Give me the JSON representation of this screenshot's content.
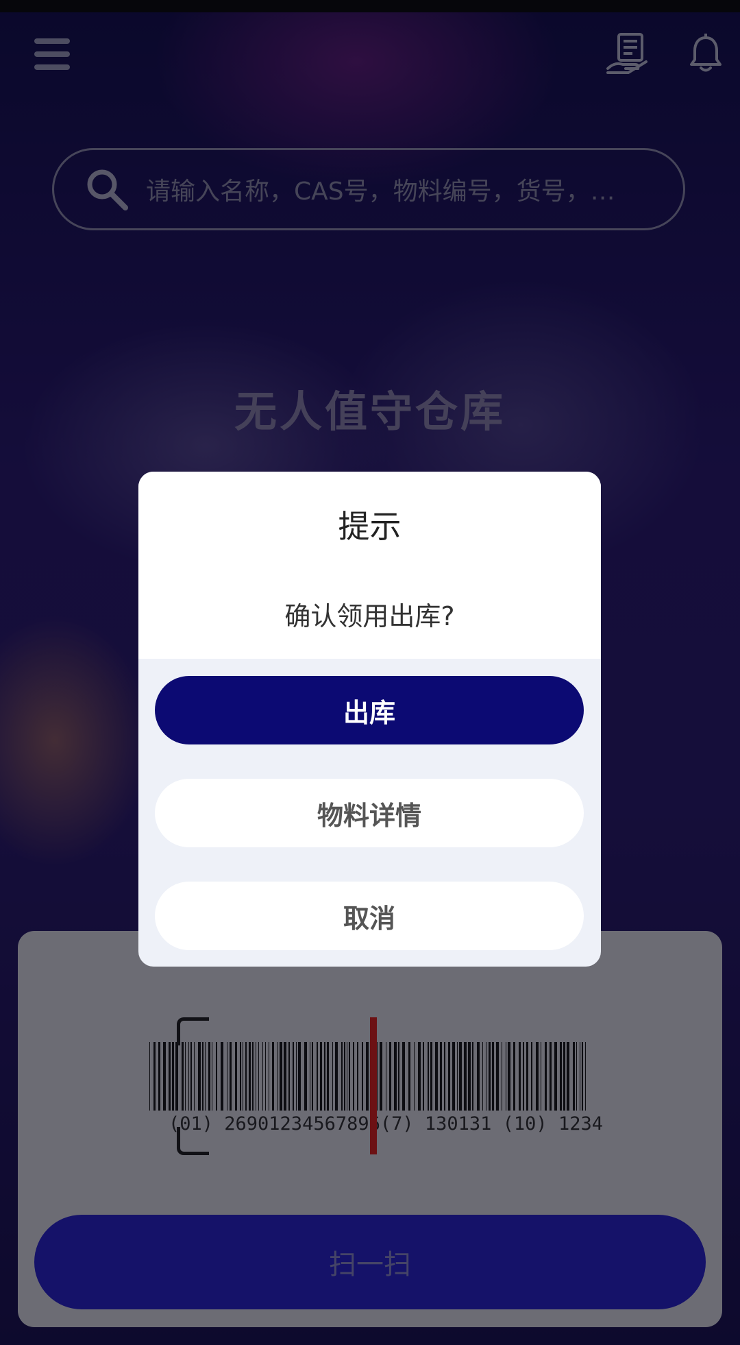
{
  "header": {
    "menu_icon": "hamburger-menu-icon",
    "record_icon": "receipt-hand-icon",
    "notification_icon": "bell-icon"
  },
  "search": {
    "icon": "search-icon",
    "placeholder": "请输入名称，CAS号，物料编号，货号，…"
  },
  "hero": {
    "title": "无人值守仓库"
  },
  "barcode_card": {
    "barcode_text": "(01) 26901234567896(7) 130131 (10) 1234",
    "scan_button_label": "扫一扫"
  },
  "dialog": {
    "title": "提示",
    "message": "确认领用出库?",
    "primary_button": "出库",
    "secondary_button": "物料详情",
    "cancel_button": "取消"
  },
  "colors": {
    "primary": "#0c0a73",
    "scan_button": "#2a25c8",
    "scan_line": "#d9221f"
  }
}
